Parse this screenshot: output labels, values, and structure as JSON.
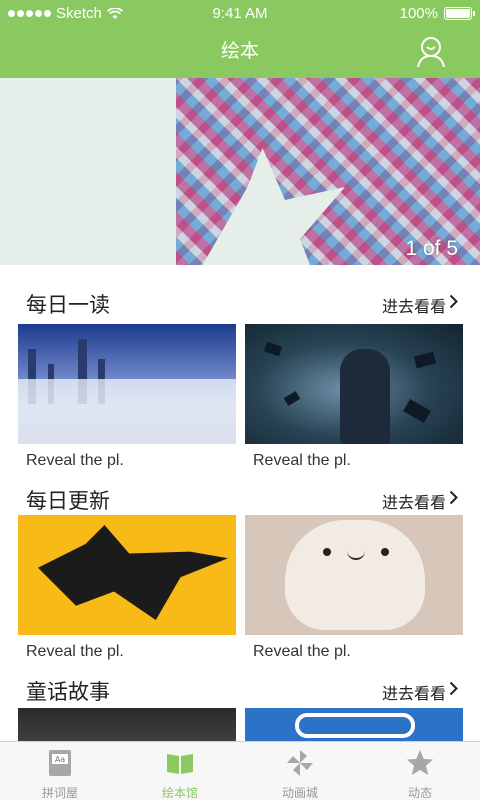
{
  "status": {
    "carrier": "Sketch",
    "time": "9:41 AM",
    "battery": "100%"
  },
  "nav": {
    "title": "绘本",
    "profile_icon": "user-profile-icon"
  },
  "banner": {
    "pager": "1 of 5"
  },
  "sections": [
    {
      "title": "每日一读",
      "more": "进去看看",
      "items": [
        {
          "caption": "Reveal the pl."
        },
        {
          "caption": "Reveal the pl."
        }
      ]
    },
    {
      "title": "每日更新",
      "more": "进去看看",
      "items": [
        {
          "caption": "Reveal the pl."
        },
        {
          "caption": "Reveal the pl."
        }
      ]
    },
    {
      "title": "童话故事",
      "more": "进去看看",
      "items": [
        {
          "caption": ""
        },
        {
          "caption": ""
        }
      ]
    }
  ],
  "tabbar": {
    "tabs": [
      {
        "label": "拼词屋",
        "icon": "book-aa-icon",
        "active": false
      },
      {
        "label": "绘本馆",
        "icon": "open-book-icon",
        "active": true
      },
      {
        "label": "动画城",
        "icon": "pinwheel-icon",
        "active": false
      },
      {
        "label": "动态",
        "icon": "star-icon",
        "active": false
      }
    ]
  },
  "colors": {
    "accent": "#8ac960",
    "inactive": "#999999"
  }
}
